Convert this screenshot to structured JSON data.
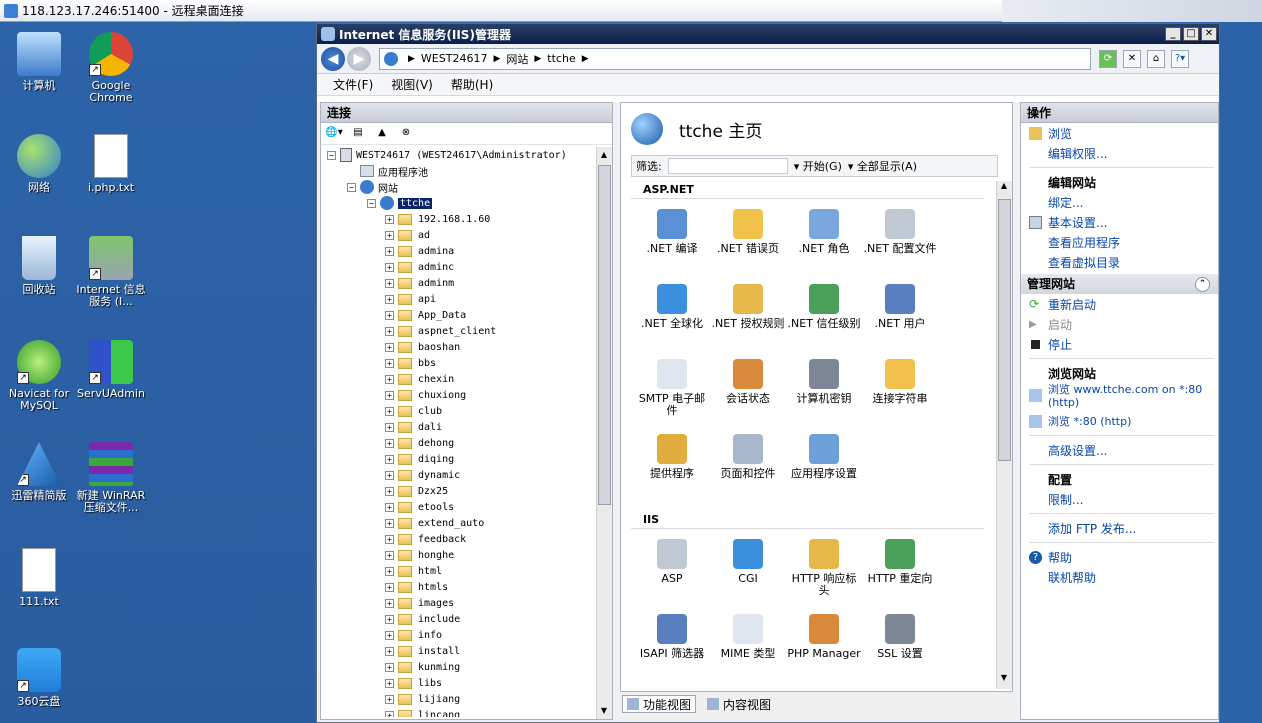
{
  "rdp": {
    "title": "118.123.17.246:51400 - 远程桌面连接"
  },
  "desktop": {
    "icons": [
      {
        "label": "计算机"
      },
      {
        "label": "Google Chrome"
      },
      {
        "label": "网络"
      },
      {
        "label": "i.php.txt"
      },
      {
        "label": "回收站"
      },
      {
        "label": "Internet 信息服务 (I..."
      },
      {
        "label": "Navicat for MySQL"
      },
      {
        "label": "ServUAdmin"
      },
      {
        "label": "迅雷精简版"
      },
      {
        "label": "新建 WinRAR 压缩文件..."
      },
      {
        "label": "111.txt"
      },
      {
        "label": "360云盘"
      }
    ]
  },
  "iis": {
    "title": "Internet 信息服务(IIS)管理器",
    "address": {
      "parts": [
        "WEST24617",
        "网站",
        "ttche"
      ]
    },
    "menu": [
      "文件(F)",
      "视图(V)",
      "帮助(H)"
    ],
    "left": {
      "header": "连接",
      "server": "WEST24617 (WEST24617\\Administrator)",
      "app_pool": "应用程序池",
      "sites": "网站",
      "site": "ttche",
      "folders": [
        "192.168.1.60",
        "ad",
        "admina",
        "adminc",
        "adminm",
        "api",
        "App_Data",
        "aspnet_client",
        "baoshan",
        "bbs",
        "chexin",
        "chuxiong",
        "club",
        "dali",
        "dehong",
        "diqing",
        "dynamic",
        "Dzx25",
        "etools",
        "extend_auto",
        "feedback",
        "honghe",
        "html",
        "htmls",
        "images",
        "include",
        "info",
        "install",
        "kunming",
        "libs",
        "lijiang",
        "lincang"
      ]
    },
    "center": {
      "title": "ttche 主页",
      "filter_label": "筛选:",
      "start_label": "开始(G)",
      "show_all_label": "全部显示(A)",
      "groups": [
        {
          "name": "ASP.NET",
          "items": [
            ".NET 编译",
            ".NET 错误页",
            ".NET 角色",
            ".NET 配置文件",
            ".NET 全球化",
            ".NET 授权规则",
            ".NET 信任级别",
            ".NET 用户",
            "SMTP 电子邮件",
            "会话状态",
            "计算机密钥",
            "连接字符串",
            "提供程序",
            "页面和控件",
            "应用程序设置"
          ]
        },
        {
          "name": "IIS",
          "items": [
            "ASP",
            "CGI",
            "HTTP 响应标头",
            "HTTP 重定向",
            "ISAPI 筛选器",
            "MIME 类型",
            "PHP Manager",
            "SSL 设置"
          ]
        }
      ],
      "view_tabs": [
        "功能视图",
        "内容视图"
      ]
    },
    "actions": {
      "header": "操作",
      "top": [
        {
          "label": "浏览",
          "type": "link"
        },
        {
          "label": "编辑权限...",
          "type": "link"
        }
      ],
      "edit_site": {
        "title": "编辑网站",
        "items": [
          "绑定...",
          "基本设置...",
          "查看应用程序",
          "查看虚拟目录"
        ]
      },
      "manage": {
        "title": "管理网站",
        "restart": "重新启动",
        "start": "启动",
        "stop": "停止",
        "browse_title": "浏览网站",
        "browse1": "浏览 www.ttche.com on *:80 (http)",
        "browse2": "浏览 *:80 (http)",
        "advanced": "高级设置...",
        "config_title": "配置",
        "limits": "限制...",
        "ftp": "添加 FTP 发布..."
      },
      "help": "帮助",
      "online_help": "联机帮助"
    }
  }
}
